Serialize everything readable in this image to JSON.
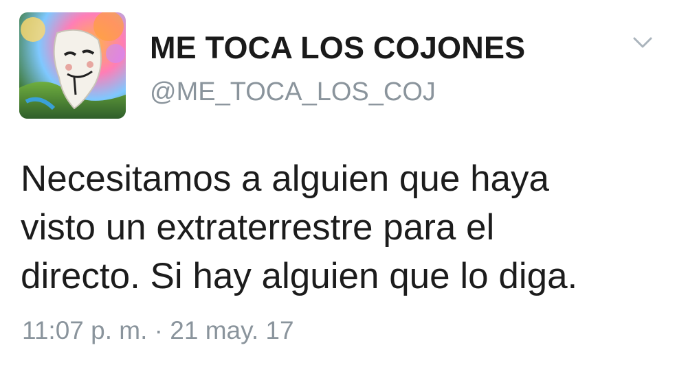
{
  "tweet": {
    "author": {
      "display_name": "ME TOCA LOS COJONES",
      "handle": "@ME_TOCA_LOS_COJ",
      "avatar_icon": "anonymous-mask-avatar"
    },
    "menu_icon": "chevron-down-icon",
    "text_lines": [
      "Necesitamos a alguien que haya",
      "visto un extraterrestre para el",
      "directo. Si hay alguien que lo diga."
    ],
    "time": "11:07 p. m.",
    "separator": "·",
    "date": "21 may. 17"
  },
  "colors": {
    "name_text": "#1a1a1a",
    "secondary_text": "#8a949c",
    "body_text": "#1c1c1c",
    "chevron": "#aab4bc",
    "background": "#ffffff"
  }
}
